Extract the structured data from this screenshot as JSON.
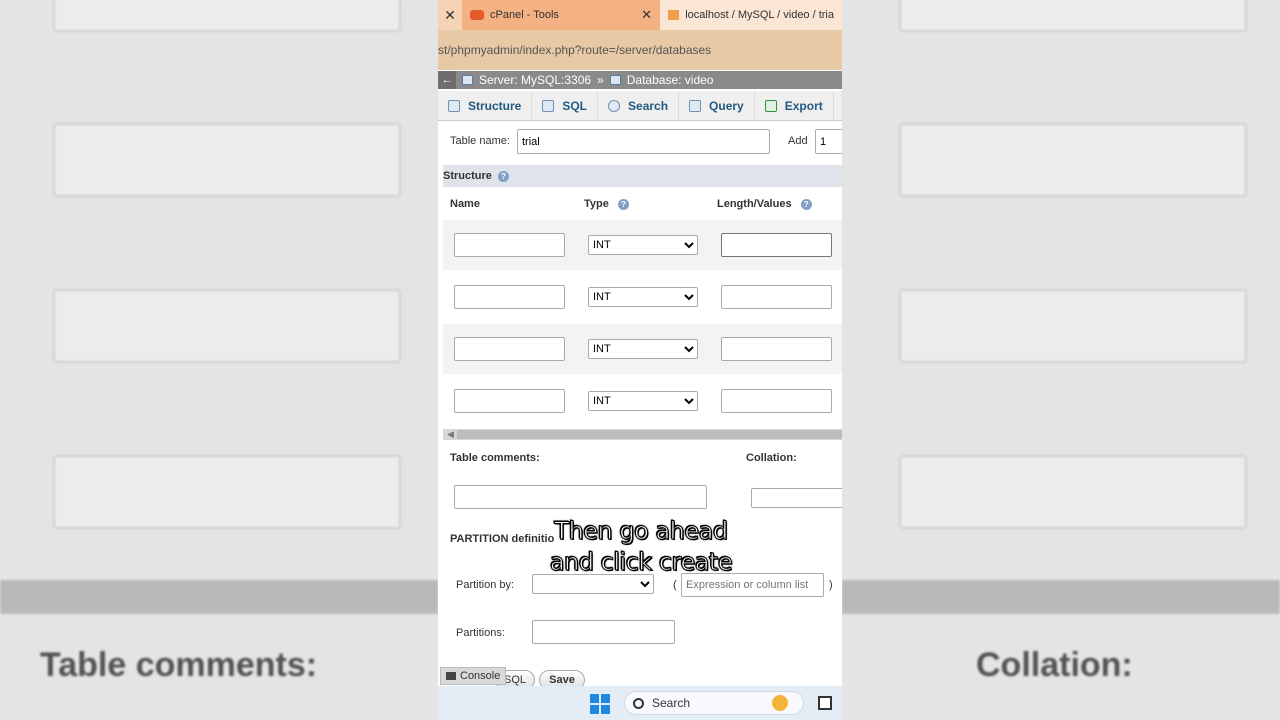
{
  "background": {
    "left_text": "Table comments:",
    "right_text": "Collation:"
  },
  "tabs": [
    {
      "label": "cPanel - Tools",
      "icon": "cpanel-icon"
    },
    {
      "label": "localhost / MySQL / video / tria",
      "icon": "phpmyadmin-icon"
    }
  ],
  "url": "st/phpmyadmin/index.php?route=/server/databases",
  "breadcrumb": {
    "server": "Server: MySQL:3306",
    "separator": "»",
    "database": "Database: video"
  },
  "menu": [
    {
      "label": "Structure",
      "icon": "structure-icon"
    },
    {
      "label": "SQL",
      "icon": "sql-icon"
    },
    {
      "label": "Search",
      "icon": "search-icon"
    },
    {
      "label": "Query",
      "icon": "query-icon"
    },
    {
      "label": "Export",
      "icon": "export-icon"
    }
  ],
  "form": {
    "table_name_label": "Table name:",
    "table_name_value": "trial",
    "add_label": "Add",
    "add_value": "1",
    "structure_label": "Structure",
    "col_name": "Name",
    "col_type": "Type",
    "col_length": "Length/Values",
    "rows": [
      {
        "name": "",
        "type": "INT",
        "length": ""
      },
      {
        "name": "",
        "type": "INT",
        "length": ""
      },
      {
        "name": "",
        "type": "INT",
        "length": ""
      },
      {
        "name": "",
        "type": "INT",
        "length": ""
      }
    ],
    "table_comments_label": "Table comments:",
    "collation_label": "Collation:",
    "partition_label": "PARTITION definitio",
    "partition_by_label": "Partition by:",
    "partition_by_value": "",
    "open_paren": "(",
    "close_paren": ")",
    "expression_placeholder": "Expression or column list",
    "partitions_label": "Partitions:"
  },
  "caption": {
    "line1": "Then go ahead",
    "line2": "and click create"
  },
  "console_label": "Console",
  "buttons": {
    "sql_label": "SQL",
    "save_label": "Save"
  },
  "taskbar": {
    "search_label": "Search"
  }
}
